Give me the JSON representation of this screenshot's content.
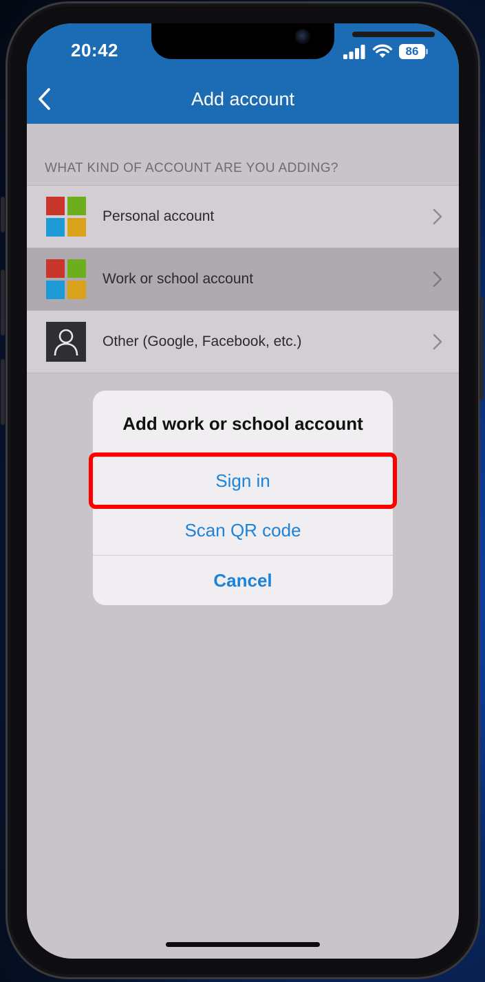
{
  "status_bar": {
    "time": "20:42",
    "battery_level": "86",
    "signal_icon": "cellular-signal-icon",
    "wifi_icon": "wifi-icon"
  },
  "header": {
    "title": "Add account",
    "back_icon": "chevron-left-icon",
    "background_color": "#1c6cb5"
  },
  "section_label": "WHAT KIND OF ACCOUNT ARE YOU ADDING?",
  "accounts": [
    {
      "label": "Personal account",
      "icon": "microsoft-logo-icon"
    },
    {
      "label": "Work or school account",
      "icon": "microsoft-logo-icon",
      "selected": true
    },
    {
      "label": "Other (Google, Facebook, etc.)",
      "icon": "person-icon"
    }
  ],
  "dialog": {
    "title": "Add work or school account",
    "sign_in": "Sign in",
    "scan_qr": "Scan QR code",
    "cancel": "Cancel",
    "action_color": "#1d83d8",
    "highlight_color": "#ff0000"
  }
}
